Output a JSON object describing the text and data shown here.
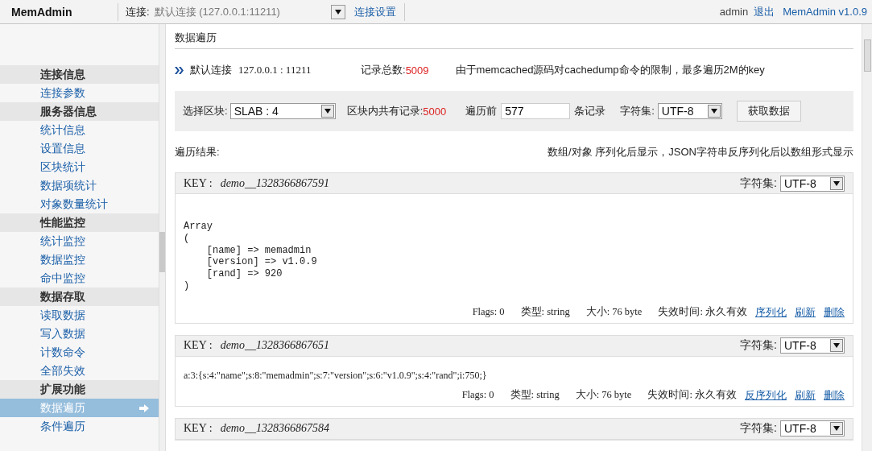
{
  "top_bar": {
    "logo": "MemAdmin",
    "connection_label": "连接:",
    "connection_value": "默认连接 (127.0.0.1:11211)",
    "connection_settings": "连接设置",
    "user": "admin",
    "logout": "退出",
    "version": "MemAdmin v1.0.9"
  },
  "sidebar": {
    "groups": [
      {
        "title": "连接信息",
        "items": [
          {
            "label": "连接参数",
            "selected": false
          }
        ]
      },
      {
        "title": "服务器信息",
        "items": [
          {
            "label": "统计信息",
            "selected": false
          },
          {
            "label": "设置信息",
            "selected": false
          },
          {
            "label": "区块统计",
            "selected": false
          },
          {
            "label": "数据项统计",
            "selected": false
          },
          {
            "label": "对象数量统计",
            "selected": false
          }
        ]
      },
      {
        "title": "性能监控",
        "items": [
          {
            "label": "统计监控",
            "selected": false
          },
          {
            "label": "数据监控",
            "selected": false
          },
          {
            "label": "命中监控",
            "selected": false
          }
        ]
      },
      {
        "title": "数据存取",
        "items": [
          {
            "label": "读取数据",
            "selected": false
          },
          {
            "label": "写入数据",
            "selected": false
          },
          {
            "label": "计数命令",
            "selected": false
          },
          {
            "label": "全部失效",
            "selected": false
          }
        ]
      },
      {
        "title": "扩展功能",
        "items": [
          {
            "label": "数据遍历",
            "selected": true
          },
          {
            "label": "条件遍历",
            "selected": false
          }
        ]
      }
    ]
  },
  "main": {
    "title": "数据遍历",
    "connection_name": "默认连接",
    "connection_address": "127.0.0.1 : 11211",
    "total_label": "记录总数:",
    "total_value": "5009",
    "note": "由于memcached源码对cachedump命令的限制，最多遍历2M的key",
    "filter": {
      "slab_label": "选择区块:",
      "slab_value": "SLAB : 4",
      "block_label": "区块内共有记录:",
      "block_value": "5000",
      "first_label": "遍历前",
      "first_value": "577",
      "records_label": "条记录",
      "charset_label": "字符集:",
      "charset_value": "UTF-8",
      "fetch_button": "获取数据"
    },
    "results_label": "遍历结果:",
    "results_note": "数组/对象 序列化后显示，JSON字符串反序列化后以数组形式显示",
    "entries": [
      {
        "kind": "array",
        "key_label": "KEY :",
        "key": "demo__1328366867591",
        "charset_label": "字符集:",
        "charset_value": "UTF-8",
        "content": "Array\n(\n    [name] => memadmin\n    [version] => v1.0.9\n    [rand] => 920\n)",
        "meta": [
          "Flags: 0",
          "类型: string",
          "大小: 76 byte",
          "失效时间: 永久有效"
        ],
        "actions": [
          "序列化",
          "刷新",
          "删除"
        ]
      },
      {
        "kind": "serialized",
        "key_label": "KEY :",
        "key": "demo__1328366867651",
        "charset_label": "字符集:",
        "charset_value": "UTF-8",
        "content": "a:3:{s:4:\"name\";s:8:\"memadmin\";s:7:\"version\";s:6:\"v1.0.9\";s:4:\"rand\";i:750;}",
        "meta": [
          "Flags: 0",
          "类型: string",
          "大小: 76 byte",
          "失效时间: 永久有效"
        ],
        "actions": [
          "反序列化",
          "刷新",
          "删除"
        ]
      },
      {
        "kind": "collapsed",
        "key_label": "KEY :",
        "key": "demo__1328366867584",
        "charset_label": "字符集:",
        "charset_value": "UTF-8"
      }
    ]
  }
}
